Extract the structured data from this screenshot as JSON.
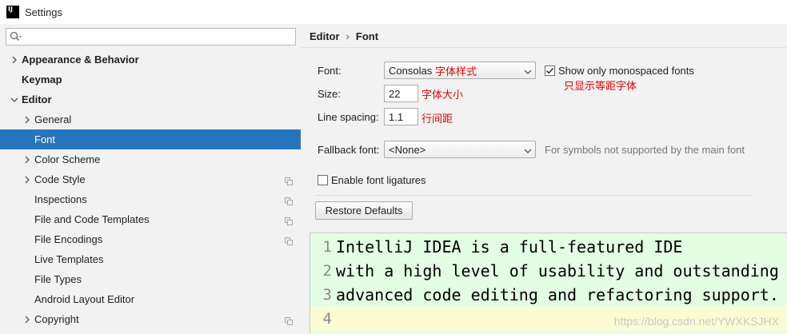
{
  "window": {
    "title": "Settings",
    "app_icon_text": "IJ"
  },
  "search": {
    "value": "",
    "placeholder": ""
  },
  "sidebar": {
    "items": [
      {
        "label": "Appearance & Behavior",
        "bold": true,
        "chevron": "right",
        "indent": 0,
        "copy_icon": false,
        "selected": false
      },
      {
        "label": "Keymap",
        "bold": true,
        "chevron": "none",
        "indent": 0,
        "copy_icon": false,
        "selected": false
      },
      {
        "label": "Editor",
        "bold": true,
        "chevron": "down",
        "indent": 0,
        "copy_icon": false,
        "selected": false
      },
      {
        "label": "General",
        "bold": false,
        "chevron": "right",
        "indent": 1,
        "copy_icon": false,
        "selected": false
      },
      {
        "label": "Font",
        "bold": false,
        "chevron": "none",
        "indent": 1,
        "copy_icon": false,
        "selected": true
      },
      {
        "label": "Color Scheme",
        "bold": false,
        "chevron": "right",
        "indent": 1,
        "copy_icon": false,
        "selected": false
      },
      {
        "label": "Code Style",
        "bold": false,
        "chevron": "right",
        "indent": 1,
        "copy_icon": true,
        "selected": false
      },
      {
        "label": "Inspections",
        "bold": false,
        "chevron": "none",
        "indent": 1,
        "copy_icon": true,
        "selected": false
      },
      {
        "label": "File and Code Templates",
        "bold": false,
        "chevron": "none",
        "indent": 1,
        "copy_icon": true,
        "selected": false
      },
      {
        "label": "File Encodings",
        "bold": false,
        "chevron": "none",
        "indent": 1,
        "copy_icon": true,
        "selected": false
      },
      {
        "label": "Live Templates",
        "bold": false,
        "chevron": "none",
        "indent": 1,
        "copy_icon": false,
        "selected": false
      },
      {
        "label": "File Types",
        "bold": false,
        "chevron": "none",
        "indent": 1,
        "copy_icon": false,
        "selected": false
      },
      {
        "label": "Android Layout Editor",
        "bold": false,
        "chevron": "none",
        "indent": 1,
        "copy_icon": false,
        "selected": false
      },
      {
        "label": "Copyright",
        "bold": false,
        "chevron": "right",
        "indent": 1,
        "copy_icon": true,
        "selected": false
      }
    ]
  },
  "breadcrumb": {
    "parent": "Editor",
    "separator": "›",
    "current": "Font"
  },
  "form": {
    "font_label": "Font:",
    "font_value": "Consolas",
    "font_annotation": "字体样式",
    "monospace_label": "Show only monospaced fonts",
    "monospace_checked": true,
    "monospace_annotation": "只显示等距字体",
    "size_label": "Size:",
    "size_value": "22",
    "size_annotation": "字体大小",
    "spacing_label": "Line spacing:",
    "spacing_value": "1.1",
    "spacing_annotation": "行间距",
    "fallback_label": "Fallback font:",
    "fallback_value": "<None>",
    "fallback_hint": "For symbols not supported by the main font",
    "ligatures_label": "Enable font ligatures",
    "ligatures_checked": false,
    "restore_button": "Restore Defaults"
  },
  "preview": {
    "lines": [
      {
        "number": "1",
        "text": "IntelliJ IDEA is a full-featured IDE"
      },
      {
        "number": "2",
        "text": "with a high level of usability and outstanding"
      },
      {
        "number": "3",
        "text": "advanced code editing and refactoring support."
      },
      {
        "number": "4",
        "text": ""
      }
    ],
    "current_line": 4,
    "watermark": "https://blog.csdn.net/YWXKSJHX"
  },
  "colors": {
    "selection": "#2675bf",
    "preview_bg": "#e4fee4",
    "current_line_bg": "#fcfcd4",
    "annotation": "#e00000"
  },
  "icons": {
    "search": "search-icon",
    "chevron_right": "chevron-right-icon",
    "chevron_down": "chevron-down-icon",
    "copy": "project-scope-icon",
    "dropdown": "chevron-down-icon",
    "check": "checkmark-icon"
  }
}
